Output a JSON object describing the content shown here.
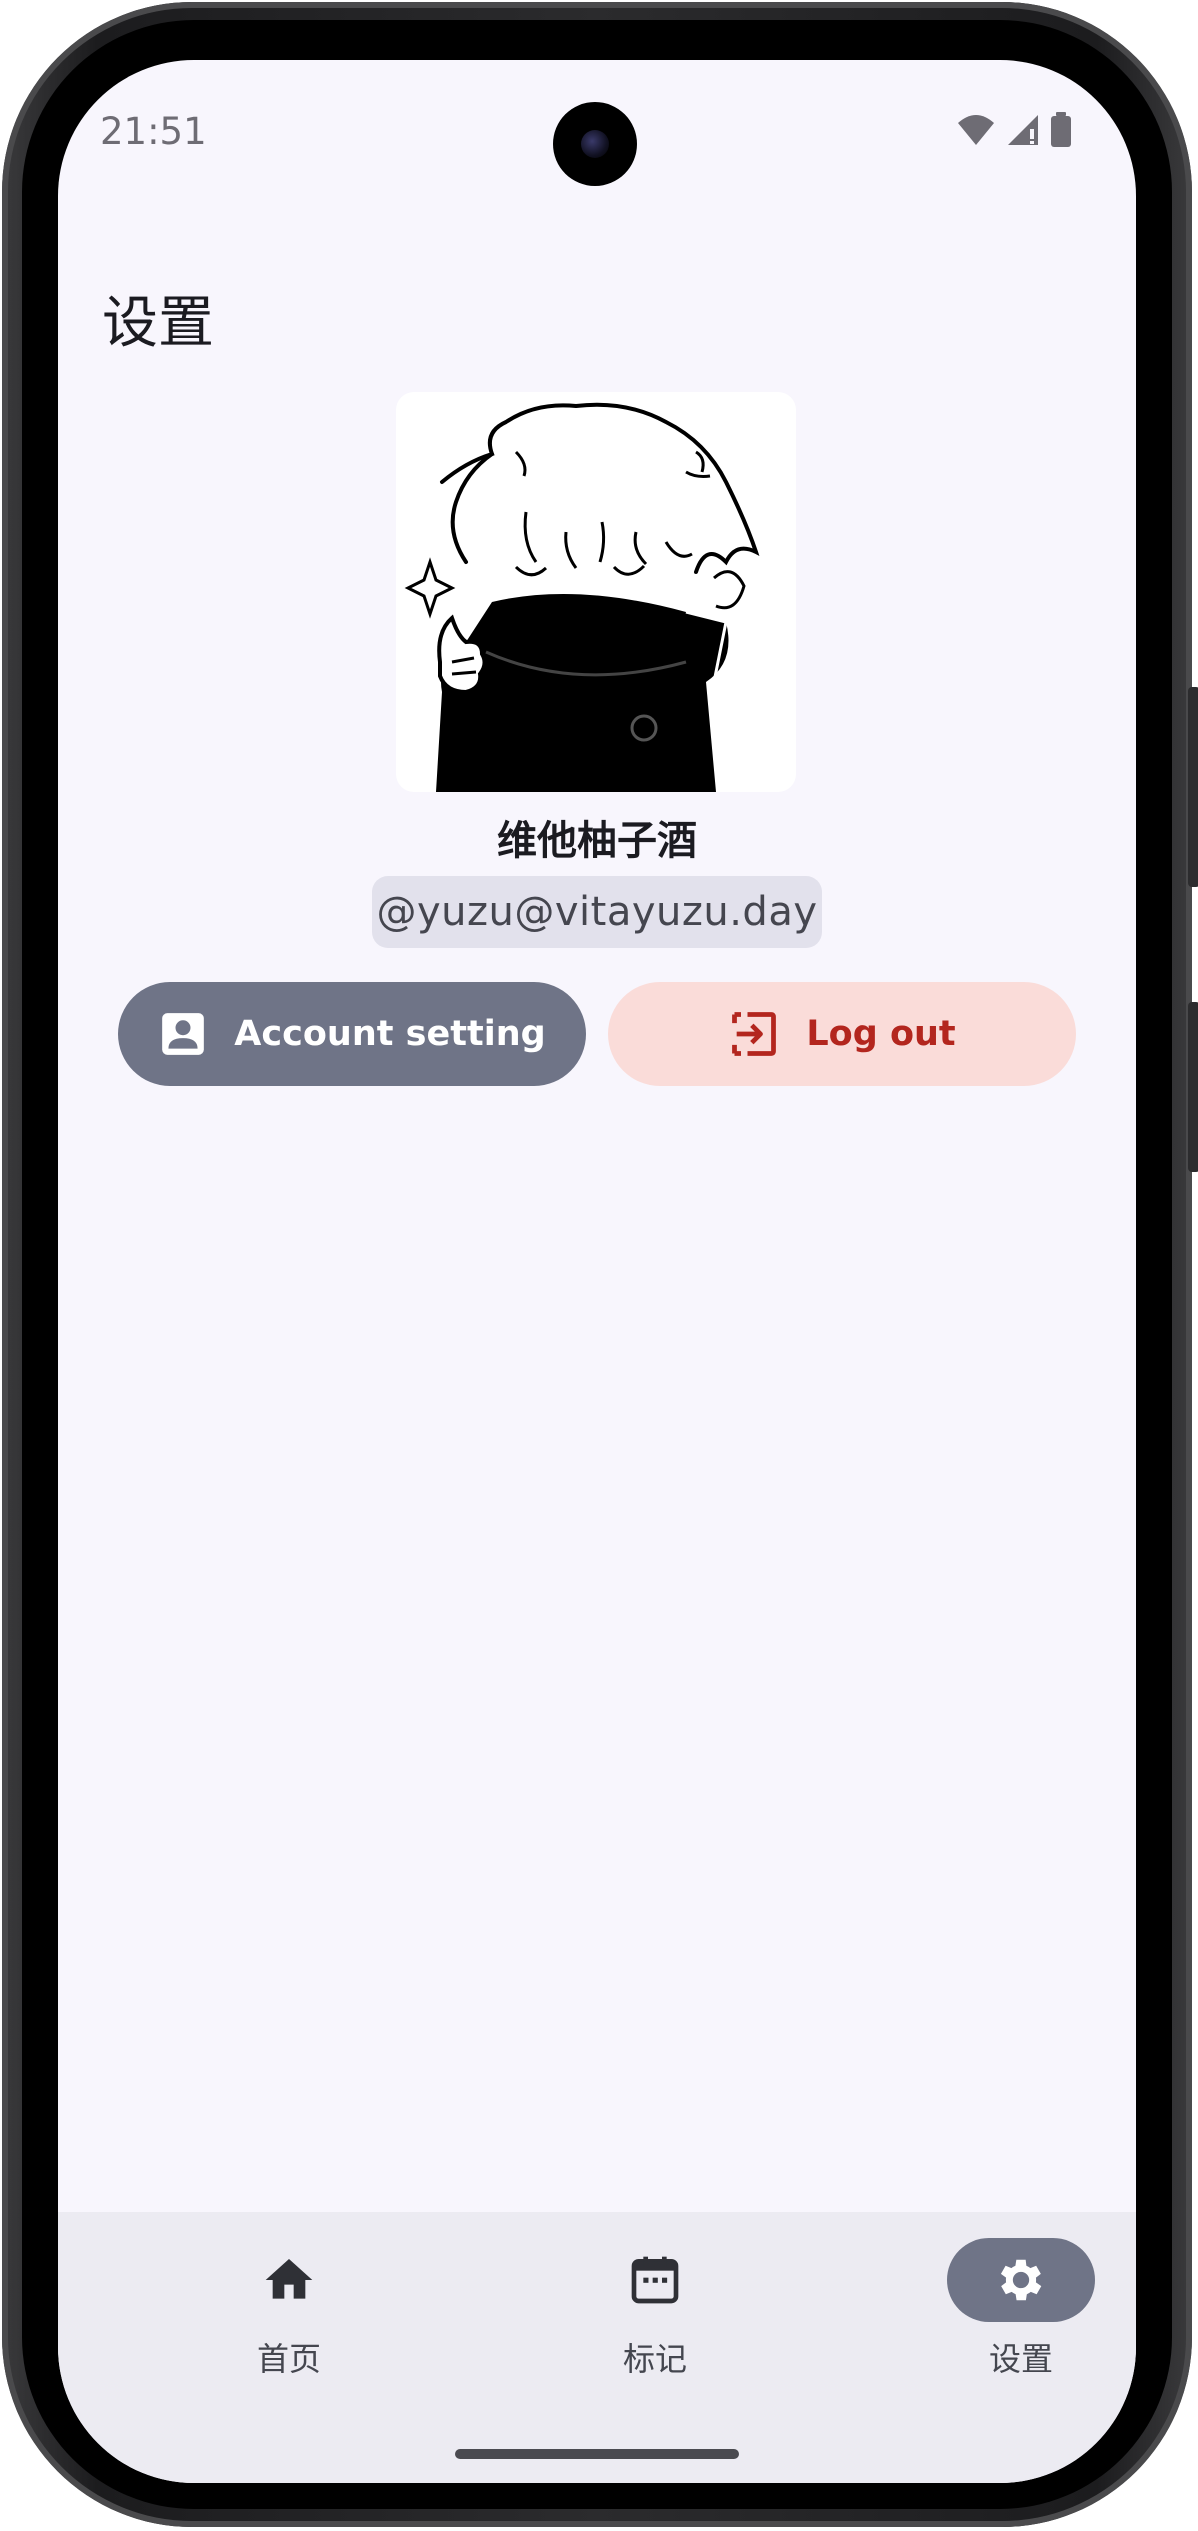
{
  "status_bar": {
    "time": "21:51",
    "icons": [
      "wifi-icon",
      "cell-signal-icon",
      "battery-icon"
    ]
  },
  "page": {
    "title": "设置"
  },
  "profile": {
    "display_name": "维他柚子酒",
    "handle": "@yuzu@vitayuzu.day"
  },
  "actions": {
    "account_setting_label": "Account setting",
    "logout_label": "Log out"
  },
  "nav": {
    "items": [
      {
        "label": "首页",
        "icon": "home-icon",
        "active": false
      },
      {
        "label": "标记",
        "icon": "calendar-icon",
        "active": false
      },
      {
        "label": "设置",
        "icon": "gear-icon",
        "active": true
      }
    ]
  },
  "colors": {
    "background": "#f8f6fd",
    "secondary_button": "#6f7487",
    "logout_bg": "#fadcd9",
    "logout_fg": "#b3261e",
    "navbar_bg": "#ecebf2"
  }
}
